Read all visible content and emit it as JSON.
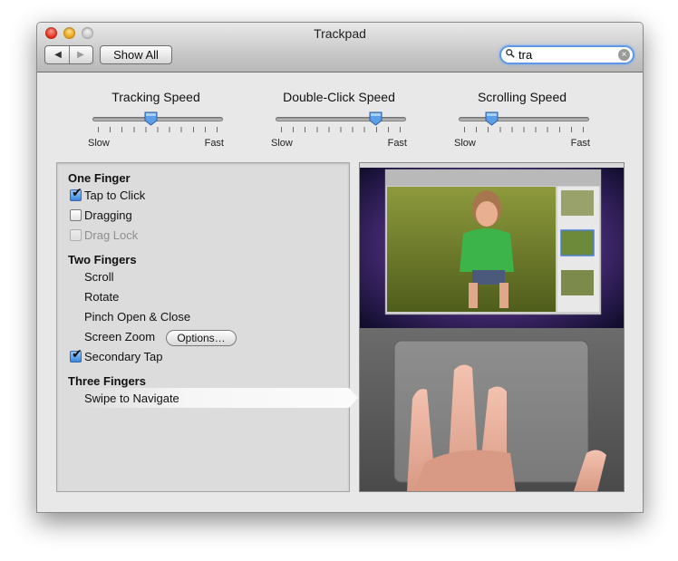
{
  "window": {
    "title": "Trackpad",
    "show_all_label": "Show All",
    "nav_back_icon": "◀",
    "nav_forward_icon": "▶"
  },
  "search": {
    "value": "tra",
    "clear_icon": "×"
  },
  "sliders": [
    {
      "title": "Tracking Speed",
      "min_label": "Slow",
      "max_label": "Fast",
      "level": 0.45
    },
    {
      "title": "Double-Click Speed",
      "min_label": "Slow",
      "max_label": "Fast",
      "level": 0.77
    },
    {
      "title": "Scrolling Speed",
      "min_label": "Slow",
      "max_label": "Fast",
      "level": 0.25
    }
  ],
  "gestures": {
    "one_finger": {
      "heading": "One Finger",
      "tap_to_click": {
        "label": "Tap to Click",
        "checked": true
      },
      "dragging": {
        "label": "Dragging",
        "checked": false
      },
      "drag_lock": {
        "label": "Drag Lock",
        "checked": false,
        "enabled": false
      }
    },
    "two_fingers": {
      "heading": "Two Fingers",
      "scroll": "Scroll",
      "rotate": "Rotate",
      "pinch": "Pinch Open & Close",
      "screen_zoom": "Screen Zoom",
      "options_button": "Options…",
      "secondary_tap": {
        "label": "Secondary Tap",
        "checked": true
      }
    },
    "three_fingers": {
      "heading": "Three Fingers",
      "swipe": "Swipe to Navigate"
    }
  },
  "colors": {
    "accent": "#3a86de",
    "search_focus": "#5d99e8"
  }
}
